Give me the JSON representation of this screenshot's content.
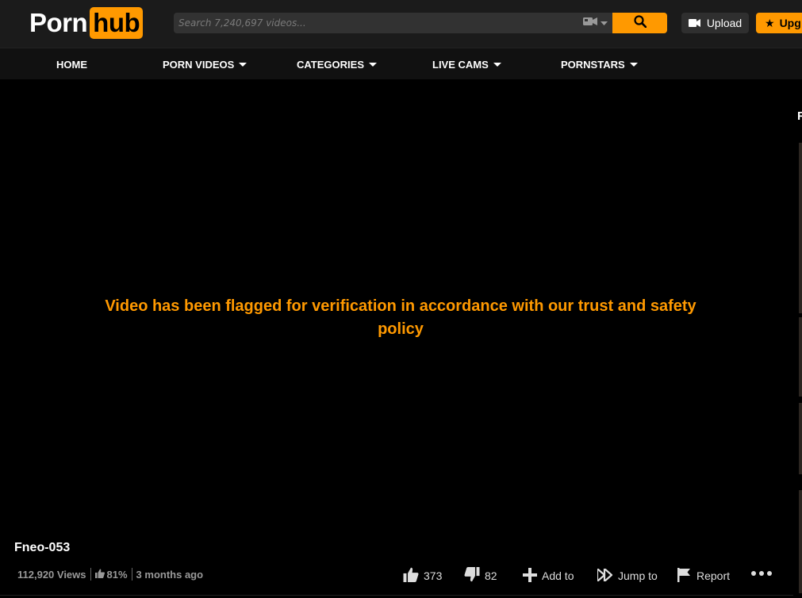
{
  "header": {
    "logo_left": "Porn",
    "logo_right": "hub",
    "search_placeholder": "Search 7,240,697 videos...",
    "upload_label": "Upload",
    "upgrade_label": "Upg"
  },
  "nav": {
    "items": [
      {
        "label": "HOME",
        "has_caret": false
      },
      {
        "label": "PORN VIDEOS",
        "has_caret": true
      },
      {
        "label": "CATEGORIES",
        "has_caret": true
      },
      {
        "label": "LIVE CAMS",
        "has_caret": true
      },
      {
        "label": "PORNSTARS",
        "has_caret": true
      }
    ]
  },
  "player": {
    "message": "Video has been flagged for verification in accordance with our trust and safety policy"
  },
  "rail": {
    "letter": "R"
  },
  "video": {
    "title": "Fneo-053",
    "views": "112,920 Views",
    "rating": "81%",
    "age": "3 months ago",
    "likes": "373",
    "dislikes": "82",
    "add_to_label": "Add to",
    "jump_to_label": "Jump to",
    "report_label": "Report"
  },
  "colors": {
    "accent": "#ff9900",
    "header_bg": "#1b1b1b",
    "nav_bg": "#111111"
  }
}
